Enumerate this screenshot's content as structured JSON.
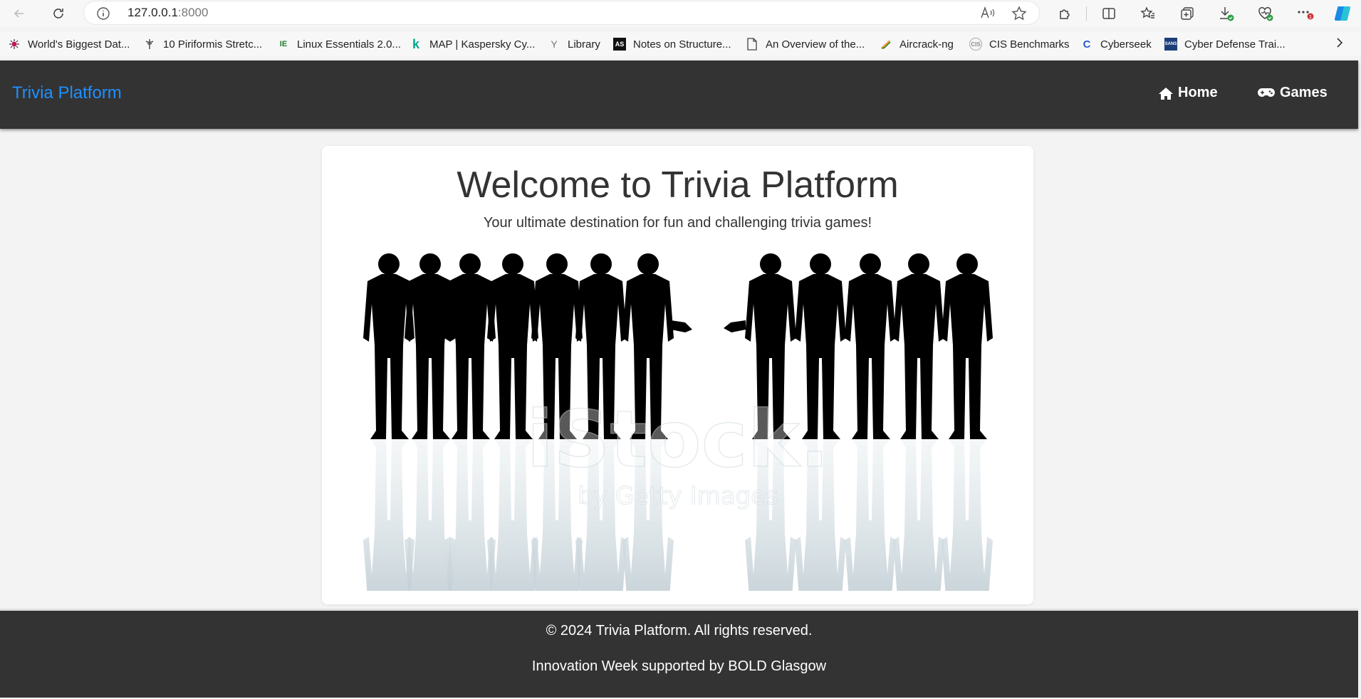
{
  "browser": {
    "url_host": "127.0.0.1",
    "url_port": ":8000",
    "bookmarks": [
      "World's Biggest Dat...",
      "10 Piriformis Stretc...",
      "Linux Essentials 2.0...",
      "MAP | Kaspersky Cy...",
      "Library",
      "Notes on Structure...",
      "An Overview of the...",
      "Aircrack-ng",
      "CIS Benchmarks",
      "Cyberseek",
      "Cyber Defense Trai..."
    ],
    "bookmark_icons": [
      "",
      "",
      "IE",
      "k",
      "Y",
      "AS",
      "",
      "",
      "CIS",
      "C",
      "SANS"
    ]
  },
  "nav": {
    "brand": "Trivia Platform",
    "home": "Home",
    "games": "Games"
  },
  "main": {
    "title": "Welcome to Trivia Platform",
    "subtitle": "Your ultimate destination for fun and challenging trivia games!",
    "watermark_main": "iStock.",
    "watermark_sub": "by Getty Images"
  },
  "footer": {
    "copyright": "© 2024 Trivia Platform. All rights reserved.",
    "support": "Innovation Week supported by BOLD Glasgow"
  },
  "colors": {
    "brand": "#1e90ff",
    "navbar": "#333333",
    "page_bg": "#f3f3f3"
  }
}
